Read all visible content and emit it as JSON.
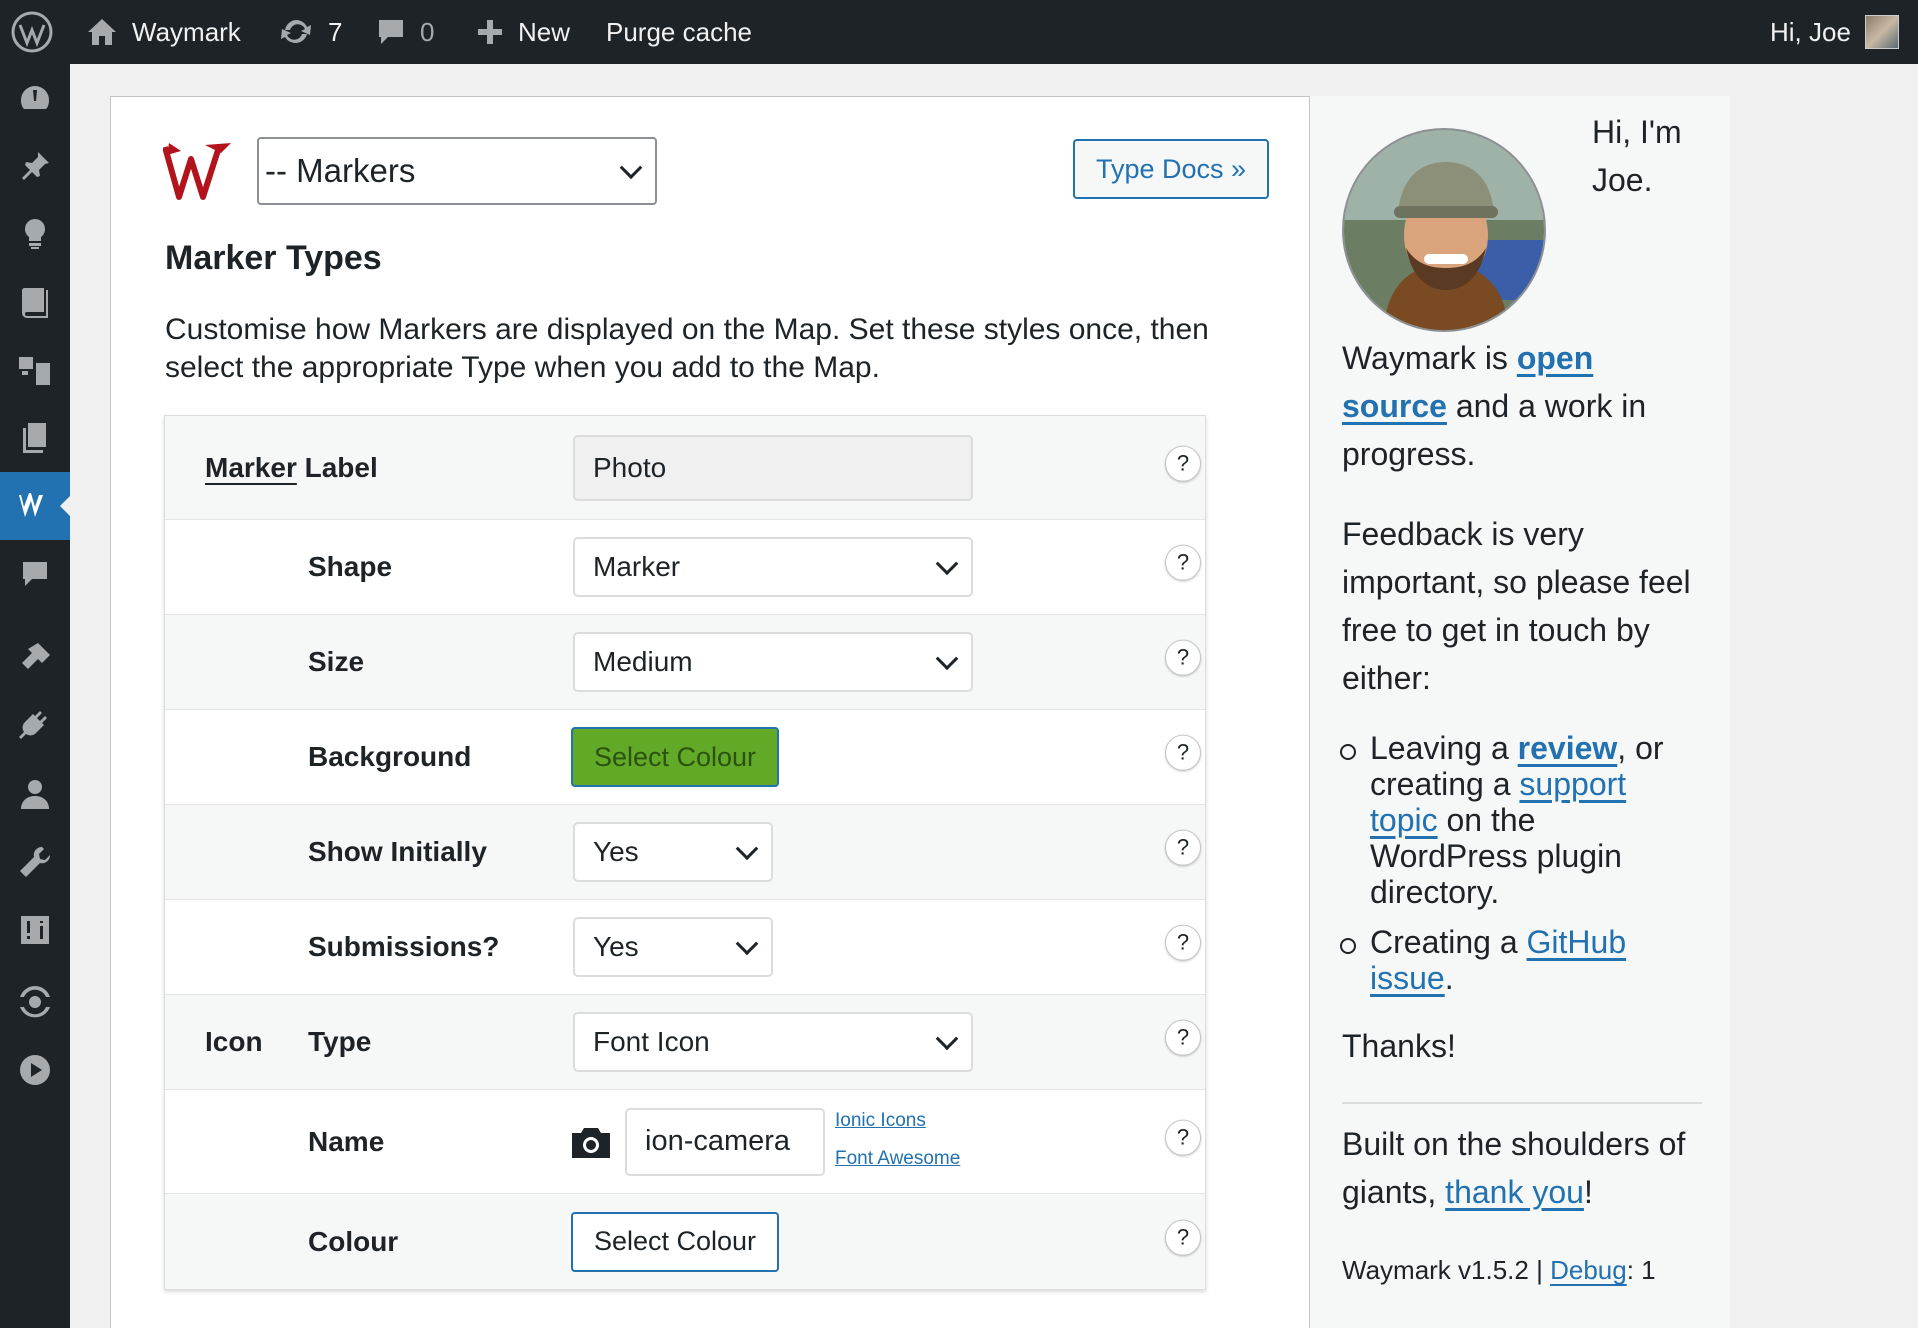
{
  "adminbar": {
    "site_name": "Waymark",
    "updates_count": "7",
    "comments_count": "0",
    "new_label": "New",
    "purge_label": "Purge cache",
    "greeting": "Hi, Joe"
  },
  "editor": {
    "preset_value": "-- Markers",
    "docs_button": "Type Docs »",
    "title": "Marker Types",
    "description": "Customise how Markers are displayed on the Map. Set these styles once, then select the appropriate Type when you add to the Map.",
    "rows": {
      "label": {
        "group": "Marker",
        "label": "Label",
        "value": "Photo"
      },
      "shape": {
        "label": "Shape",
        "value": "Marker"
      },
      "size": {
        "label": "Size",
        "value": "Medium"
      },
      "background": {
        "label": "Background",
        "button": "Select Colour",
        "color": "#61a926"
      },
      "show_initially": {
        "label": "Show Initially",
        "value": "Yes"
      },
      "submissions": {
        "label": "Submissions?",
        "value": "Yes"
      },
      "icon_type": {
        "group": "Icon",
        "label": "Type",
        "value": "Font Icon"
      },
      "icon_name": {
        "label": "Name",
        "value": "ion-camera",
        "link1": "Ionic Icons",
        "link2": "Font Awesome"
      },
      "icon_colour": {
        "label": "Colour",
        "button": "Select Colour"
      }
    },
    "help_glyph": "?"
  },
  "aside": {
    "intro": "Hi, I'm Joe.",
    "waymark_is": "Waymark is",
    "open": "open",
    "source": "source",
    "work_in": "and a work in",
    "progress": "progress.",
    "feedback_1": "Feedback is very",
    "feedback_2": "important, so please feel",
    "feedback_3": "free to get in touch by",
    "feedback_4": "either:",
    "li1_a": "Leaving a",
    "li1_review": "review",
    "li1_b": ", or",
    "li1_c": "creating a",
    "li1_support": "support",
    "li1_topic": "topic",
    "li1_d": "on the",
    "li1_e": "WordPress plugin",
    "li1_f": "directory.",
    "li2_a": "Creating a",
    "li2_github": "GitHub",
    "li2_issue": "issue",
    "li2_b": ".",
    "thanks": "Thanks!",
    "shoulders_1": "Built on the shoulders of",
    "shoulders_2": "giants,",
    "thank_you": "thank you",
    "excl": "!",
    "version": "Waymark v1.5.2 |",
    "debug": "Debug",
    "debug_val": ": 1"
  },
  "colors": {
    "accent": "#2271b1",
    "bar": "#1d2327",
    "brand_red": "#b3141c"
  }
}
